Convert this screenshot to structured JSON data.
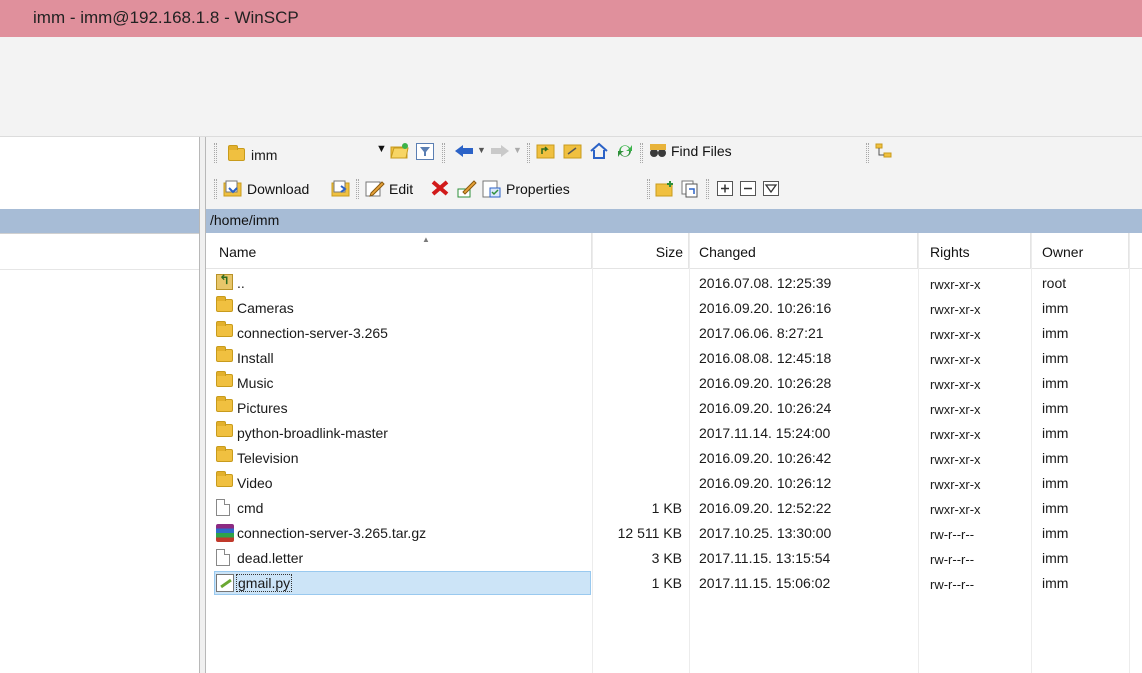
{
  "window": {
    "title": "imm - imm@192.168.1.8 - WinSCP"
  },
  "toolbar1": {
    "path_combo": "imm",
    "find_files_label": "Find Files"
  },
  "toolbar2": {
    "download_label": "Download",
    "edit_label": "Edit",
    "properties_label": "Properties"
  },
  "remote": {
    "path": "/home/imm",
    "columns": [
      "Name",
      "Size",
      "Changed",
      "Rights",
      "Owner"
    ],
    "rows": [
      {
        "name": "..",
        "size": "",
        "changed": "2016.07.08. 12:25:39",
        "rights": "rwxr-xr-x",
        "owner": "root",
        "icon": "parent-directory-icon"
      },
      {
        "name": "Cameras",
        "size": "",
        "changed": "2016.09.20. 10:26:16",
        "rights": "rwxr-xr-x",
        "owner": "imm",
        "icon": "folder-icon"
      },
      {
        "name": "connection-server-3.265",
        "size": "",
        "changed": "2017.06.06. 8:27:21",
        "rights": "rwxr-xr-x",
        "owner": "imm",
        "icon": "folder-icon"
      },
      {
        "name": "Install",
        "size": "",
        "changed": "2016.08.08. 12:45:18",
        "rights": "rwxr-xr-x",
        "owner": "imm",
        "icon": "folder-icon"
      },
      {
        "name": "Music",
        "size": "",
        "changed": "2016.09.20. 10:26:28",
        "rights": "rwxr-xr-x",
        "owner": "imm",
        "icon": "folder-icon"
      },
      {
        "name": "Pictures",
        "size": "",
        "changed": "2016.09.20. 10:26:24",
        "rights": "rwxr-xr-x",
        "owner": "imm",
        "icon": "folder-icon"
      },
      {
        "name": "python-broadlink-master",
        "size": "",
        "changed": "2017.11.14. 15:24:00",
        "rights": "rwxr-xr-x",
        "owner": "imm",
        "icon": "folder-icon"
      },
      {
        "name": "Television",
        "size": "",
        "changed": "2016.09.20. 10:26:42",
        "rights": "rwxr-xr-x",
        "owner": "imm",
        "icon": "folder-icon"
      },
      {
        "name": "Video",
        "size": "",
        "changed": "2016.09.20. 10:26:12",
        "rights": "rwxr-xr-x",
        "owner": "imm",
        "icon": "folder-icon"
      },
      {
        "name": "cmd",
        "size": "1 KB",
        "changed": "2016.09.20. 12:52:22",
        "rights": "rwxr-xr-x",
        "owner": "imm",
        "icon": "file-icon"
      },
      {
        "name": "connection-server-3.265.tar.gz",
        "size": "12 511 KB",
        "changed": "2017.10.25. 13:30:00",
        "rights": "rw-r--r--",
        "owner": "imm",
        "icon": "archive-icon"
      },
      {
        "name": "dead.letter",
        "size": "3 KB",
        "changed": "2017.11.15. 13:15:54",
        "rights": "rw-r--r--",
        "owner": "imm",
        "icon": "file-icon"
      },
      {
        "name": "gmail.py",
        "size": "1 KB",
        "changed": "2017.11.15. 15:06:02",
        "rights": "rw-r--r--",
        "owner": "imm",
        "icon": "python-script-icon",
        "selected": true
      }
    ]
  },
  "colors": {
    "titlebar": "#e0909c",
    "pathbar": "#a7bcd6",
    "selection": "#cce4f7"
  }
}
